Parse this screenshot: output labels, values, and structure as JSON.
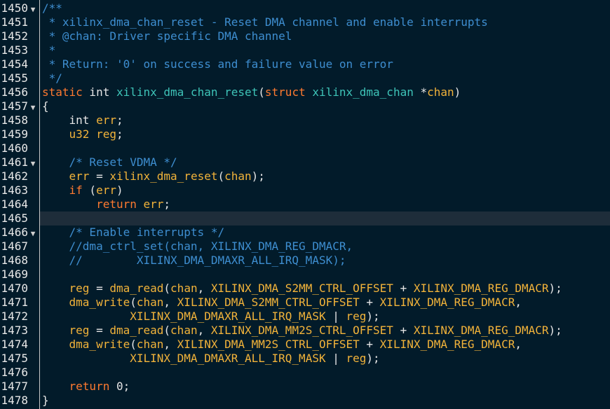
{
  "colors": {
    "background": "#021b2a",
    "current_line": "#1e2d3a",
    "comment": "#3e8ed0",
    "keyword": "#ff7a30",
    "identifier": "#f2b33a",
    "function_name": "#3ec4b8",
    "plain": "#e6e6e6"
  },
  "editor": {
    "current_line_number": "1465",
    "lines": [
      {
        "number": "1450",
        "fold": "▼",
        "tokens": [
          {
            "t": "comment",
            "text": "/**"
          }
        ]
      },
      {
        "number": "1451",
        "fold": "",
        "tokens": [
          {
            "t": "comment",
            "text": " * xilinx_dma_chan_reset - Reset DMA channel and enable interrupts"
          }
        ]
      },
      {
        "number": "1452",
        "fold": "",
        "tokens": [
          {
            "t": "comment",
            "text": " * @chan: Driver specific DMA channel"
          }
        ]
      },
      {
        "number": "1453",
        "fold": "",
        "tokens": [
          {
            "t": "comment",
            "text": " *"
          }
        ]
      },
      {
        "number": "1454",
        "fold": "",
        "tokens": [
          {
            "t": "comment",
            "text": " * Return: '0' on success and failure value on error"
          }
        ]
      },
      {
        "number": "1455",
        "fold": "",
        "tokens": [
          {
            "t": "comment",
            "text": " */"
          }
        ]
      },
      {
        "number": "1456",
        "fold": "",
        "tokens": [
          {
            "t": "keyword",
            "text": "static"
          },
          {
            "t": "punct",
            "text": " int "
          },
          {
            "t": "func",
            "text": "xilinx_dma_chan_reset"
          },
          {
            "t": "punct",
            "text": "("
          },
          {
            "t": "keyword",
            "text": "struct"
          },
          {
            "t": "punct",
            "text": " "
          },
          {
            "t": "struct",
            "text": "xilinx_dma_chan"
          },
          {
            "t": "punct",
            "text": " *"
          },
          {
            "t": "var",
            "text": "chan"
          },
          {
            "t": "punct",
            "text": ")"
          }
        ]
      },
      {
        "number": "1457",
        "fold": "▼",
        "tokens": [
          {
            "t": "punct",
            "text": "{"
          }
        ]
      },
      {
        "number": "1458",
        "fold": "",
        "tokens": [
          {
            "t": "punct",
            "text": "    int "
          },
          {
            "t": "var",
            "text": "err"
          },
          {
            "t": "punct",
            "text": ";"
          }
        ]
      },
      {
        "number": "1459",
        "fold": "",
        "tokens": [
          {
            "t": "punct",
            "text": "    "
          },
          {
            "t": "var",
            "text": "u32 reg"
          },
          {
            "t": "punct",
            "text": ";"
          }
        ]
      },
      {
        "number": "1460",
        "fold": "",
        "tokens": []
      },
      {
        "number": "1461",
        "fold": "▼",
        "tokens": [
          {
            "t": "comment",
            "text": "    /* Reset VDMA */"
          }
        ]
      },
      {
        "number": "1462",
        "fold": "",
        "tokens": [
          {
            "t": "punct",
            "text": "    "
          },
          {
            "t": "var",
            "text": "err"
          },
          {
            "t": "punct",
            "text": " = "
          },
          {
            "t": "var",
            "text": "xilinx_dma_reset"
          },
          {
            "t": "punct",
            "text": "("
          },
          {
            "t": "var",
            "text": "chan"
          },
          {
            "t": "punct",
            "text": ");"
          }
        ]
      },
      {
        "number": "1463",
        "fold": "",
        "tokens": [
          {
            "t": "punct",
            "text": "    "
          },
          {
            "t": "keyword",
            "text": "if"
          },
          {
            "t": "punct",
            "text": " ("
          },
          {
            "t": "var",
            "text": "err"
          },
          {
            "t": "punct",
            "text": ")"
          }
        ]
      },
      {
        "number": "1464",
        "fold": "",
        "tokens": [
          {
            "t": "punct",
            "text": "        "
          },
          {
            "t": "keyword",
            "text": "return"
          },
          {
            "t": "punct",
            "text": " "
          },
          {
            "t": "var",
            "text": "err"
          },
          {
            "t": "punct",
            "text": ";"
          }
        ]
      },
      {
        "number": "1465",
        "fold": "",
        "tokens": []
      },
      {
        "number": "1466",
        "fold": "▼",
        "tokens": [
          {
            "t": "comment",
            "text": "    /* Enable interrupts */"
          }
        ]
      },
      {
        "number": "1467",
        "fold": "",
        "tokens": [
          {
            "t": "comment",
            "text": "    //dma_ctrl_set(chan, XILINX_DMA_REG_DMACR,"
          }
        ]
      },
      {
        "number": "1468",
        "fold": "",
        "tokens": [
          {
            "t": "comment",
            "text": "    //        XILINX_DMA_DMAXR_ALL_IRQ_MASK);"
          }
        ]
      },
      {
        "number": "1469",
        "fold": "",
        "tokens": []
      },
      {
        "number": "1470",
        "fold": "",
        "tokens": [
          {
            "t": "punct",
            "text": "    "
          },
          {
            "t": "var",
            "text": "reg"
          },
          {
            "t": "punct",
            "text": " = "
          },
          {
            "t": "var",
            "text": "dma_read"
          },
          {
            "t": "punct",
            "text": "("
          },
          {
            "t": "var",
            "text": "chan"
          },
          {
            "t": "punct",
            "text": ", "
          },
          {
            "t": "macro",
            "text": "XILINX_DMA_S2MM_CTRL_OFFSET"
          },
          {
            "t": "punct",
            "text": " + "
          },
          {
            "t": "macro",
            "text": "XILINX_DMA_REG_DMACR"
          },
          {
            "t": "punct",
            "text": ");"
          }
        ]
      },
      {
        "number": "1471",
        "fold": "",
        "tokens": [
          {
            "t": "punct",
            "text": "    "
          },
          {
            "t": "var",
            "text": "dma_write"
          },
          {
            "t": "punct",
            "text": "("
          },
          {
            "t": "var",
            "text": "chan"
          },
          {
            "t": "punct",
            "text": ", "
          },
          {
            "t": "macro",
            "text": "XILINX_DMA_S2MM_CTRL_OFFSET"
          },
          {
            "t": "punct",
            "text": " + "
          },
          {
            "t": "macro",
            "text": "XILINX_DMA_REG_DMACR"
          },
          {
            "t": "punct",
            "text": ","
          }
        ]
      },
      {
        "number": "1472",
        "fold": "",
        "tokens": [
          {
            "t": "punct",
            "text": "             "
          },
          {
            "t": "macro",
            "text": "XILINX_DMA_DMAXR_ALL_IRQ_MASK"
          },
          {
            "t": "punct",
            "text": " | "
          },
          {
            "t": "var",
            "text": "reg"
          },
          {
            "t": "punct",
            "text": ");"
          }
        ]
      },
      {
        "number": "1473",
        "fold": "",
        "tokens": [
          {
            "t": "punct",
            "text": "    "
          },
          {
            "t": "var",
            "text": "reg"
          },
          {
            "t": "punct",
            "text": " = "
          },
          {
            "t": "var",
            "text": "dma_read"
          },
          {
            "t": "punct",
            "text": "("
          },
          {
            "t": "var",
            "text": "chan"
          },
          {
            "t": "punct",
            "text": ", "
          },
          {
            "t": "macro",
            "text": "XILINX_DMA_MM2S_CTRL_OFFSET"
          },
          {
            "t": "punct",
            "text": " + "
          },
          {
            "t": "macro",
            "text": "XILINX_DMA_REG_DMACR"
          },
          {
            "t": "punct",
            "text": ");"
          }
        ]
      },
      {
        "number": "1474",
        "fold": "",
        "tokens": [
          {
            "t": "punct",
            "text": "    "
          },
          {
            "t": "var",
            "text": "dma_write"
          },
          {
            "t": "punct",
            "text": "("
          },
          {
            "t": "var",
            "text": "chan"
          },
          {
            "t": "punct",
            "text": ", "
          },
          {
            "t": "macro",
            "text": "XILINX_DMA_MM2S_CTRL_OFFSET"
          },
          {
            "t": "punct",
            "text": " + "
          },
          {
            "t": "macro",
            "text": "XILINX_DMA_REG_DMACR"
          },
          {
            "t": "punct",
            "text": ","
          }
        ]
      },
      {
        "number": "1475",
        "fold": "",
        "tokens": [
          {
            "t": "punct",
            "text": "             "
          },
          {
            "t": "macro",
            "text": "XILINX_DMA_DMAXR_ALL_IRQ_MASK"
          },
          {
            "t": "punct",
            "text": " | "
          },
          {
            "t": "var",
            "text": "reg"
          },
          {
            "t": "punct",
            "text": ");"
          }
        ]
      },
      {
        "number": "1476",
        "fold": "",
        "tokens": []
      },
      {
        "number": "1477",
        "fold": "",
        "tokens": [
          {
            "t": "punct",
            "text": "    "
          },
          {
            "t": "keyword",
            "text": "return"
          },
          {
            "t": "punct",
            "text": " 0;"
          }
        ]
      },
      {
        "number": "1478",
        "fold": "",
        "tokens": [
          {
            "t": "punct",
            "text": "}"
          }
        ]
      }
    ]
  }
}
